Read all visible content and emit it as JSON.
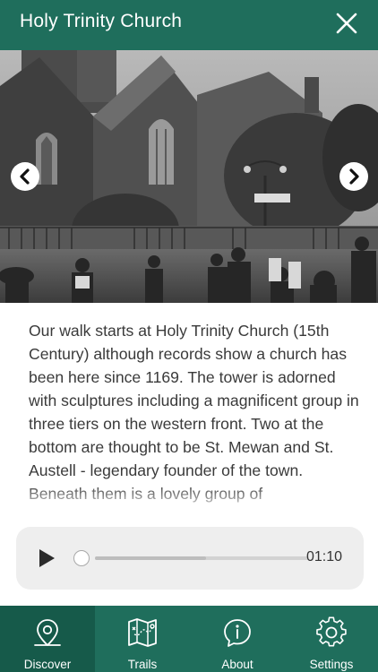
{
  "header": {
    "title": "Holy Trinity Church",
    "close_icon": "close-icon"
  },
  "carousel": {
    "prev_icon": "chevron-left-icon",
    "next_icon": "chevron-right-icon"
  },
  "description": "Our walk starts at Holy Trinity Church (15th Century) although records show a church has been here since 1169. The tower is adorned with sculptures including a magnificent group in three tiers on the western front. Two at the bottom are thought to be St. Mewan and St. Austell - legendary founder of the town. Beneath them is a lovely group of",
  "player": {
    "play_icon": "play-icon",
    "time": "01:10",
    "progress": 0.0,
    "buffered": 0.52
  },
  "tabs": [
    {
      "label": "Discover",
      "icon": "map-pin-icon",
      "active": true
    },
    {
      "label": "Trails",
      "icon": "trail-map-icon",
      "active": false
    },
    {
      "label": "About",
      "icon": "info-icon",
      "active": false
    },
    {
      "label": "Settings",
      "icon": "gear-icon",
      "active": false
    }
  ],
  "colors": {
    "brand": "#1f6e5c",
    "brand_active": "#165a4a",
    "player_bg": "#eeeeee",
    "text": "#3a3a3a"
  }
}
